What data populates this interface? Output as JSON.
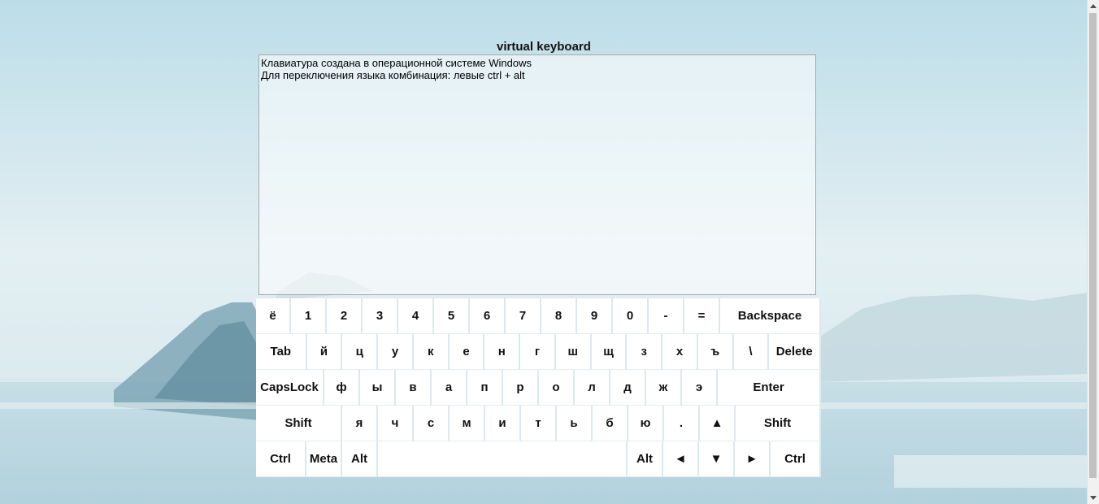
{
  "title": "virtual keyboard",
  "textarea": {
    "value": "Клавиатура создана в операционной системе Windows\nДля переключения языка комбинация: левые ctrl + alt"
  },
  "keyboard": {
    "row1": {
      "backquote": "ё",
      "k1": "1",
      "k2": "2",
      "k3": "3",
      "k4": "4",
      "k5": "5",
      "k6": "6",
      "k7": "7",
      "k8": "8",
      "k9": "9",
      "k0": "0",
      "minus": "-",
      "equal": "=",
      "backspace": "Backspace"
    },
    "row2": {
      "tab": "Tab",
      "q": "й",
      "w": "ц",
      "e": "у",
      "r": "к",
      "t": "е",
      "y": "н",
      "u": "г",
      "i": "ш",
      "o": "щ",
      "p": "з",
      "bracket_left": "х",
      "bracket_right": "ъ",
      "backslash": "\\",
      "delete": "Delete"
    },
    "row3": {
      "capslock": "CapsLock",
      "a": "ф",
      "s": "ы",
      "d": "в",
      "f": "а",
      "g": "п",
      "h": "р",
      "j": "о",
      "k": "л",
      "l": "д",
      "semicolon": "ж",
      "quote": "э",
      "enter": "Enter"
    },
    "row4": {
      "shift_left": "Shift",
      "z": "я",
      "x": "ч",
      "c": "с",
      "v": "м",
      "b": "и",
      "n": "т",
      "m": "ь",
      "comma": "б",
      "period": "ю",
      "slash": ".",
      "arrow_up": "▲",
      "shift_right": "Shift"
    },
    "row5": {
      "ctrl_left": "Ctrl",
      "meta": "Meta",
      "alt_left": "Alt",
      "space": "",
      "alt_right": "Alt",
      "arrow_left": "◄",
      "arrow_down": "▼",
      "arrow_right": "►",
      "ctrl_right": "Ctrl"
    }
  }
}
